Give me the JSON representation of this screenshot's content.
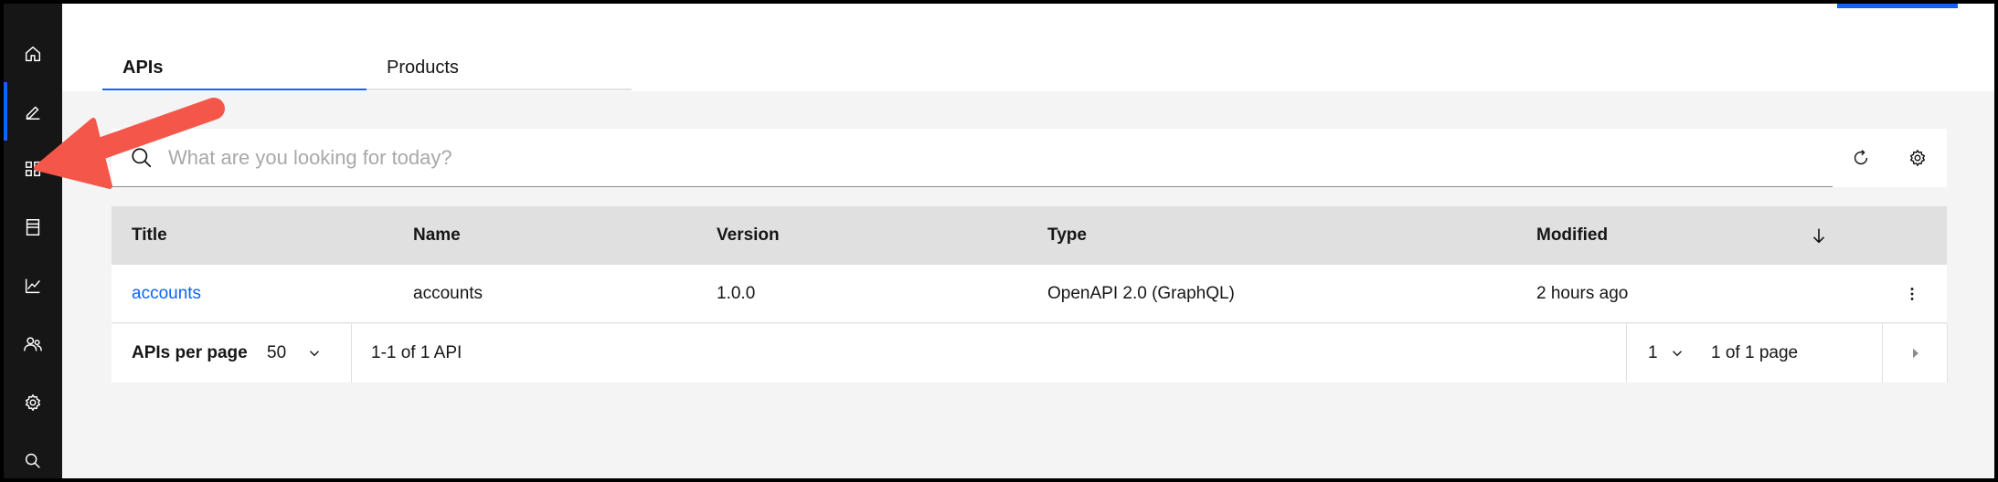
{
  "sidebar": {
    "items": [
      {
        "name": "home"
      },
      {
        "name": "develop"
      },
      {
        "name": "manage"
      },
      {
        "name": "catalog"
      },
      {
        "name": "analytics"
      },
      {
        "name": "members"
      },
      {
        "name": "settings"
      },
      {
        "name": "search"
      }
    ],
    "active_index": 1
  },
  "tabs": [
    {
      "label": "APIs",
      "active": true
    },
    {
      "label": "Products",
      "active": false
    }
  ],
  "search": {
    "placeholder": "What are you looking for today?",
    "value": ""
  },
  "table": {
    "columns": [
      "Title",
      "Name",
      "Version",
      "Type",
      "Modified"
    ],
    "rows": [
      {
        "title": "accounts",
        "name": "accounts",
        "version": "1.0.0",
        "type": "OpenAPI 2.0 (GraphQL)",
        "modified": "2 hours ago"
      }
    ]
  },
  "pagination": {
    "per_page_label": "APIs per page",
    "per_page_value": "50",
    "range_text": "1-1 of 1 API",
    "page_value": "1",
    "page_total_text": "1 of 1 page"
  },
  "colors": {
    "accent": "#0f62fe",
    "rail": "#161616",
    "annotation_arrow": "#f4574a"
  }
}
